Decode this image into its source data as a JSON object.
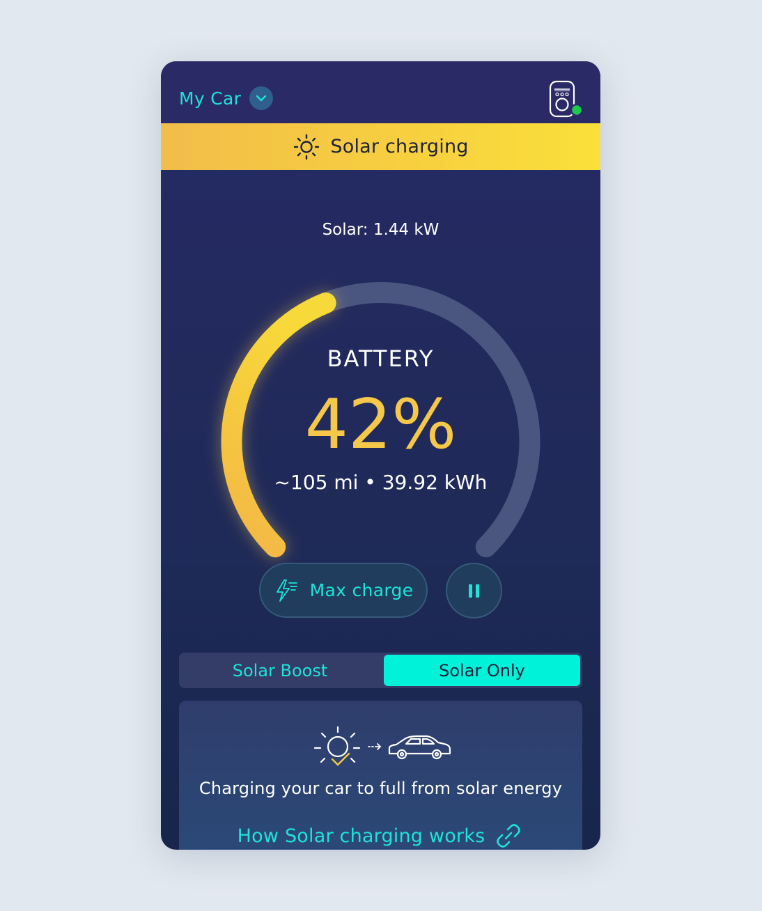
{
  "header": {
    "car_name": "My Car",
    "chevron_icon": "chevron-down-icon",
    "charger_icon": "ev-charger-icon",
    "charger_status_color": "#1ec94d"
  },
  "banner": {
    "icon": "sun-icon",
    "text": "Solar charging",
    "color": "#f7cf3f"
  },
  "solar": {
    "text": "Solar: 1.44 kW"
  },
  "battery": {
    "label": "BATTERY",
    "percent_text": "42%",
    "percent": 42,
    "detail": "~105 mi • 39.92 kWh",
    "arc_color": "#f5c84a",
    "track_color": "#4a5680"
  },
  "actions": {
    "max_charge_label": "Max charge",
    "max_charge_icon": "lightning-icon",
    "pause_icon": "pause-icon"
  },
  "mode": {
    "options": [
      "Solar Boost",
      "Solar Only"
    ],
    "selected": "Solar Only",
    "accent": "#00f2d8"
  },
  "info": {
    "icons": [
      "sun-check-icon",
      "arrow-right-icon",
      "car-icon"
    ],
    "text": "Charging your car to full from solar energy",
    "link_text": "How Solar charging works",
    "link_icon": "link-icon"
  }
}
